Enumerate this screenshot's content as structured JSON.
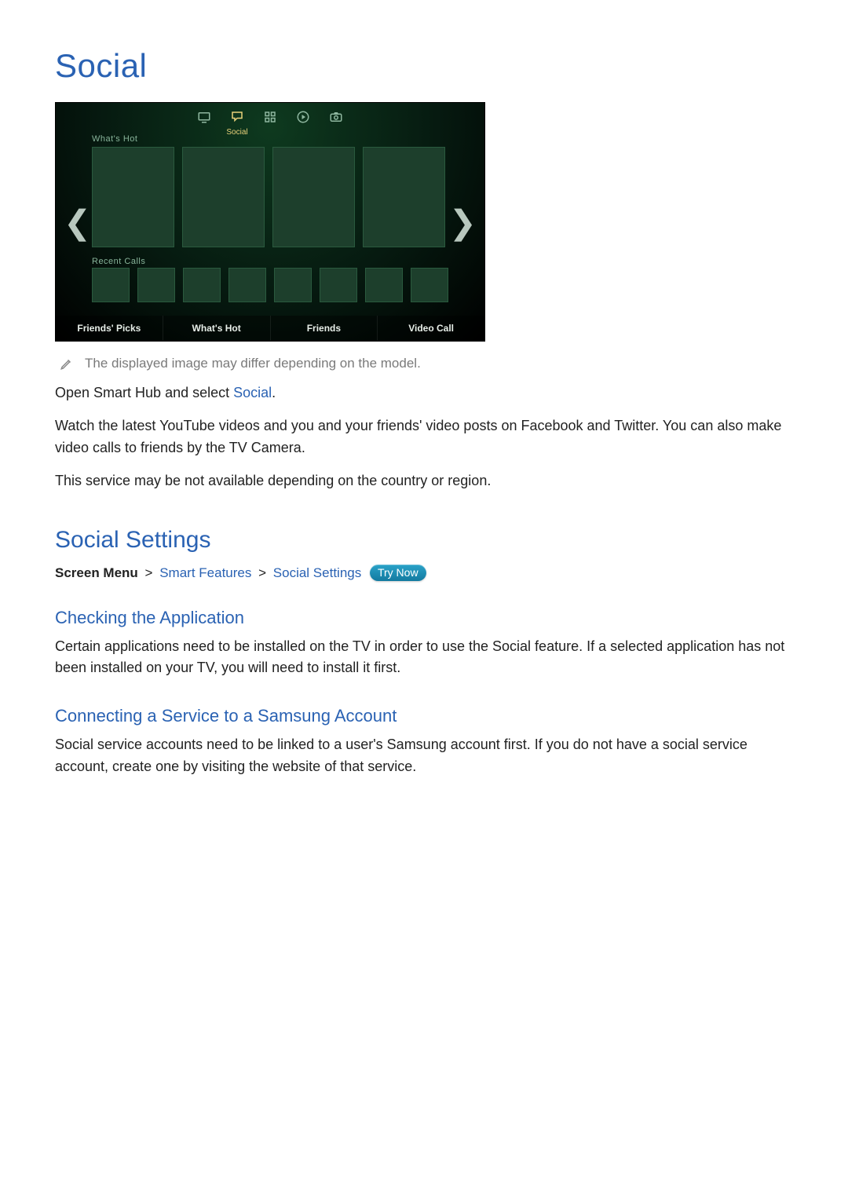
{
  "title": "Social",
  "tvshot": {
    "nav_label": "Social",
    "section_hot": "What's Hot",
    "section_recent": "Recent Calls",
    "tabs": [
      "Friends' Picks",
      "What's Hot",
      "Friends",
      "Video Call"
    ]
  },
  "note": "The displayed image may differ depending on the model.",
  "p1_pre": "Open Smart Hub and select ",
  "p1_kw": "Social",
  "p1_post": ".",
  "p2": "Watch the latest YouTube videos and you and your friends' video posts on Facebook and Twitter. You can also make video calls to friends by the TV Camera.",
  "p3": "This service may be not available depending on the country or region.",
  "settings": {
    "heading": "Social Settings",
    "path_label": "Screen Menu",
    "path_a": "Smart Features",
    "path_b": "Social Settings",
    "try_now": "Try Now"
  },
  "check": {
    "heading": "Checking the Application",
    "body": "Certain applications need to be installed on the TV in order to use the Social feature. If a selected application has not been installed on your TV, you will need to install it first."
  },
  "connect": {
    "heading": "Connecting a Service to a Samsung Account",
    "body": "Social service accounts need to be linked to a user's Samsung account first. If you do not have a social service account, create one by visiting the website of that service."
  }
}
